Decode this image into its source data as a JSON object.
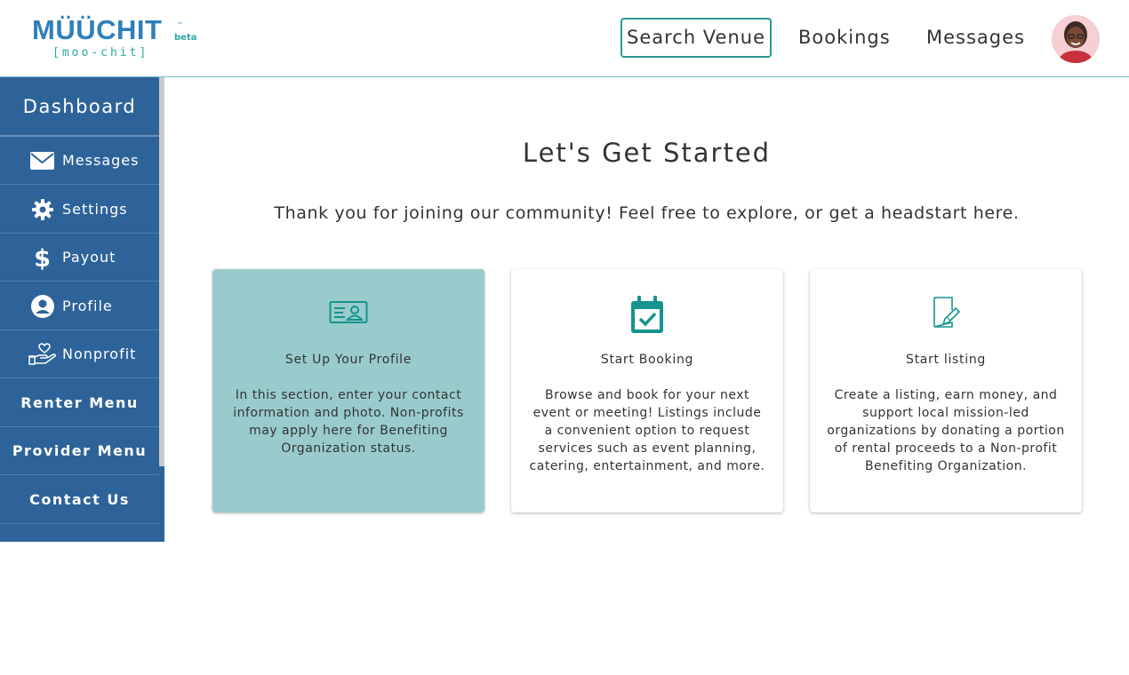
{
  "brand": {
    "name": "MÜÜCHIT",
    "tm": "™",
    "tag": "beta",
    "pronunciation": "[moo-chit]",
    "colors": {
      "blue": "#2f7fba",
      "teal": "#2aa7a0"
    }
  },
  "header": {
    "nav": {
      "search_venue": "Search Venue",
      "bookings": "Bookings",
      "messages": "Messages"
    },
    "avatar_icon": "user-avatar-photo"
  },
  "sidebar": {
    "title": "Dashboard",
    "items": [
      {
        "label": "Messages",
        "icon": "envelope-icon"
      },
      {
        "label": "Settings",
        "icon": "gear-icon"
      },
      {
        "label": "Payout",
        "icon": "dollar-icon"
      },
      {
        "label": "Profile",
        "icon": "user-circle-icon"
      },
      {
        "label": "Nonprofit",
        "icon": "hand-heart-icon"
      }
    ],
    "menus": [
      {
        "label": "Renter Menu"
      },
      {
        "label": "Provider Menu"
      },
      {
        "label": "Contact Us"
      }
    ],
    "colors": {
      "background": "#2e6399"
    }
  },
  "main": {
    "title": "Let's Get Started",
    "subtitle": "Thank you for joining our community! Feel free to explore, or get a headstart here.",
    "cards": [
      {
        "title": "Set Up Your Profile",
        "text": "In this section, enter your contact information and photo. Non-profits may apply here for Benefiting Organization status.",
        "icon": "id-card-icon",
        "active": true
      },
      {
        "title": "Start Booking",
        "text": "Browse and book for your next event or meeting! Listings include a convenient option to request services such as event planning, catering, entertainment, and more.",
        "icon": "calendar-check-icon",
        "active": false
      },
      {
        "title": "Start listing",
        "text": "Create a listing, earn money, and support local mission-led organizations by donating a portion of rental proceeds to a Non-profit Benefiting Organization.",
        "icon": "edit-document-icon",
        "active": false
      }
    ],
    "colors": {
      "accent": "#15948d",
      "active_card": "#99cbcc"
    }
  }
}
